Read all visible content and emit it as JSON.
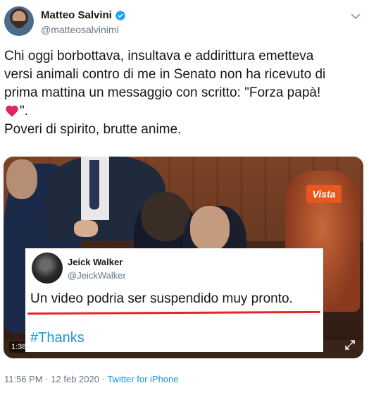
{
  "author": {
    "display_name": "Matteo Salvini",
    "handle": "@matteosalvinimi",
    "verified": true
  },
  "tweet": {
    "lines": [
      "Chi oggi borbottava, insultava e addirittura emetteva",
      "versi animali contro di me in Senato non ha ricevuto di",
      "prima mattina un messaggio con scritto: \"Forza papà!",
      "\".",
      "Poveri di spirito, brutte anime."
    ],
    "emoji": "red-heart-icon"
  },
  "media": {
    "watermark": "Vista",
    "duration": "1:38",
    "overlay": {
      "display_name": "Jeick Walker",
      "handle": "@JeickWalker",
      "text": "Un video podria ser suspendido muy pronto.",
      "hashtag": "#Thanks",
      "underline_color": "#e8232a"
    }
  },
  "footer": {
    "time": "11:56 PM",
    "separator": "·",
    "date": "12 feb 2020",
    "source": "Twitter for iPhone"
  },
  "colors": {
    "link": "#1b95e0",
    "muted": "#657786",
    "heart": "#e0245e"
  }
}
